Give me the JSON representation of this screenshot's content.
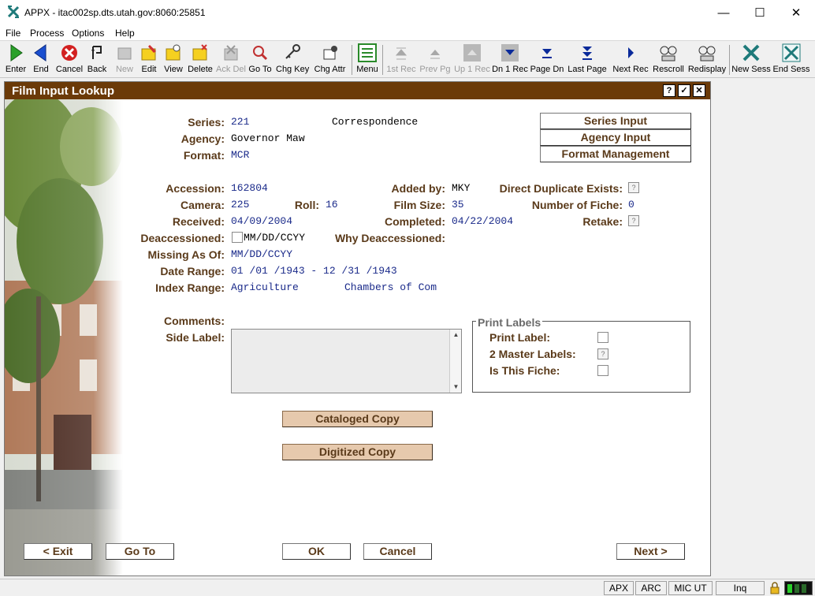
{
  "window": {
    "title": "APPX - itac002sp.dts.utah.gov:8060:25851"
  },
  "menu": [
    "File",
    "Process",
    "Options",
    "Help"
  ],
  "toolbar": [
    {
      "label": "Enter",
      "icon": "enter-icon",
      "enabled": true
    },
    {
      "label": "End",
      "icon": "end-icon",
      "enabled": true
    },
    {
      "label": "Cancel",
      "icon": "cancel-icon",
      "enabled": true
    },
    {
      "label": "Back",
      "icon": "back-icon",
      "enabled": true
    },
    {
      "label": "New",
      "icon": "new-icon",
      "enabled": false
    },
    {
      "label": "Edit",
      "icon": "edit-icon",
      "enabled": true
    },
    {
      "label": "View",
      "icon": "view-icon",
      "enabled": true
    },
    {
      "label": "Delete",
      "icon": "delete-icon",
      "enabled": true
    },
    {
      "label": "Ack Del",
      "icon": "ack-del-icon",
      "enabled": false
    },
    {
      "label": "Go To",
      "icon": "goto-icon",
      "enabled": true
    },
    {
      "label": "Chg Key",
      "icon": "key-icon",
      "enabled": true
    },
    {
      "label": "Chg Attr",
      "icon": "attr-icon",
      "enabled": true
    },
    {
      "label": "Menu",
      "icon": "menu-icon",
      "enabled": true
    },
    {
      "label": "1st Rec",
      "icon": "first-rec-icon",
      "enabled": false
    },
    {
      "label": "Prev Pg",
      "icon": "prev-page-icon",
      "enabled": false
    },
    {
      "label": "Up 1 Rec",
      "icon": "up-rec-icon",
      "enabled": false
    },
    {
      "label": "Dn 1 Rec",
      "icon": "down-rec-icon",
      "enabled": true
    },
    {
      "label": "Page Dn",
      "icon": "page-down-icon",
      "enabled": true
    },
    {
      "label": "Last Page",
      "icon": "last-page-icon",
      "enabled": true
    },
    {
      "label": "Next Rec",
      "icon": "next-rec-icon",
      "enabled": true
    },
    {
      "label": "Rescroll",
      "icon": "rescroll-icon",
      "enabled": true
    },
    {
      "label": "Redisplay",
      "icon": "redisplay-icon",
      "enabled": true
    },
    {
      "label": "New Sess",
      "icon": "new-session-icon",
      "enabled": true
    },
    {
      "label": "End Sess",
      "icon": "end-session-icon",
      "enabled": true
    }
  ],
  "form": {
    "title": "Film Input Lookup",
    "title_buttons": [
      "?",
      "✓",
      "✕"
    ],
    "series": {
      "label": "Series:",
      "code": "221",
      "name": "Correspondence"
    },
    "agency": {
      "label": "Agency:",
      "value": "Governor Maw"
    },
    "format": {
      "label": "Format:",
      "value": "MCR"
    },
    "side_buttons": [
      "Series Input",
      "Agency Input",
      "Format Management"
    ],
    "accession": {
      "label": "Accession:",
      "value": "162804"
    },
    "added_by": {
      "label": "Added by:",
      "value": "MKY"
    },
    "direct_duplicate": {
      "label": "Direct Duplicate Exists:",
      "value": "?"
    },
    "camera": {
      "label": "Camera:",
      "value": "225"
    },
    "roll": {
      "label": "Roll:",
      "value": "16"
    },
    "film_size": {
      "label": "Film Size:",
      "value": "35"
    },
    "number_of_fiche": {
      "label": "Number of Fiche:",
      "value": "0"
    },
    "received": {
      "label": "Received:",
      "value": "04/09/2004"
    },
    "completed": {
      "label": "Completed:",
      "value": "04/22/2004"
    },
    "retake": {
      "label": "Retake:",
      "value": "?"
    },
    "deaccessioned": {
      "label": "Deaccessioned:",
      "value": "MM/DD/CCYY"
    },
    "why_deaccessioned": {
      "label": "Why Deaccessioned:",
      "value": ""
    },
    "missing_as_of": {
      "label": "Missing As Of:",
      "value": "MM/DD/CCYY"
    },
    "date_range": {
      "label": "Date Range:",
      "value": "01 /01 /1943 - 12 /31 /1943"
    },
    "index_range": {
      "label": "Index Range:",
      "from": "Agriculture",
      "to": "Chambers of Com"
    },
    "comments": {
      "label": "Comments:"
    },
    "side_label": {
      "label": "Side Label:",
      "value": ""
    },
    "print_labels": {
      "title": "Print Labels",
      "items": [
        {
          "label": "Print Label:",
          "value": ""
        },
        {
          "label": "2 Master Labels:",
          "value": "?"
        },
        {
          "label": "Is This Fiche:",
          "value": ""
        }
      ]
    },
    "actions": [
      "Cataloged Copy",
      "Digitized Copy"
    ],
    "footer": {
      "exit": "< Exit",
      "goto": "Go To",
      "ok": "OK",
      "cancel": "Cancel",
      "next": "Next >"
    }
  },
  "status": {
    "panels": [
      "APX",
      "ARC",
      "MIC UT",
      "Inq"
    ]
  },
  "colors": {
    "title_bar": "#6b3a08",
    "label": "#5a3a1a",
    "value": "#1a2a8a",
    "button_tan": "#e6c9ad"
  }
}
